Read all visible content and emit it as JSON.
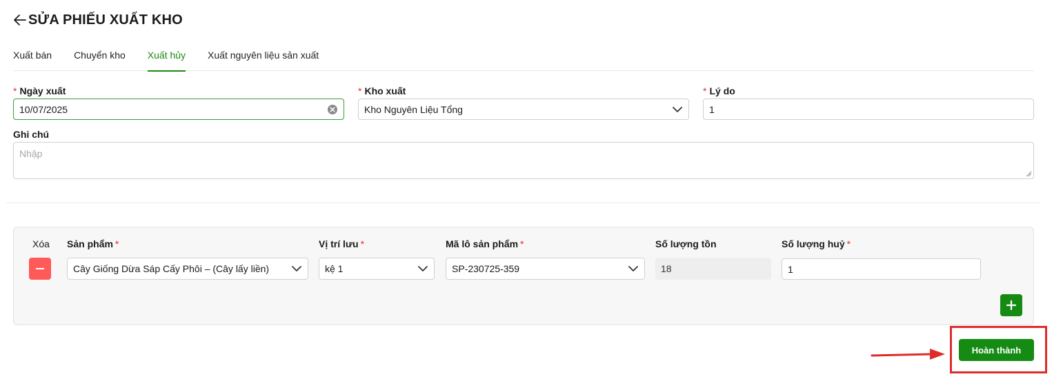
{
  "header": {
    "back_icon": "arrow-left-icon",
    "title": "SỬA PHIẾU XUẤT KHO"
  },
  "tabs": [
    {
      "label": "Xuất bán",
      "active": false
    },
    {
      "label": "Chuyển kho",
      "active": false
    },
    {
      "label": "Xuất hủy",
      "active": true
    },
    {
      "label": "Xuất nguyên liệu sản xuất",
      "active": false
    }
  ],
  "form": {
    "required_mark": "*",
    "ngay_xuat": {
      "label": "Ngày xuất",
      "value": "10/07/2025"
    },
    "kho_xuat": {
      "label": "Kho xuất",
      "value": "Kho Nguyên Liệu Tổng"
    },
    "ly_do": {
      "label": "Lý do",
      "value": "1"
    },
    "ghi_chu": {
      "label": "Ghi chú",
      "placeholder": "Nhập"
    }
  },
  "items_table": {
    "headers": {
      "xoa": "Xóa",
      "san_pham": "Sản phẩm",
      "vi_tri_luu": "Vị trí lưu",
      "ma_lo": "Mã lô sản phẩm",
      "so_luong_ton": "Số lượng tồn",
      "so_luong_huy": "Số lượng huỷ"
    },
    "rows": [
      {
        "san_pham": "Cây Giống Dừa Sáp Cấy Phôi – (Cây lấy liền)",
        "vi_tri_luu": "kệ 1",
        "ma_lo": "SP-230725-359",
        "so_luong_ton": "18",
        "so_luong_huy": "1"
      }
    ]
  },
  "actions": {
    "submit_label": "Hoàn thành"
  },
  "colors": {
    "accent": "#158b14",
    "delete": "#ff5a5a",
    "required": "#e03131",
    "annotation": "#e02a2a"
  }
}
